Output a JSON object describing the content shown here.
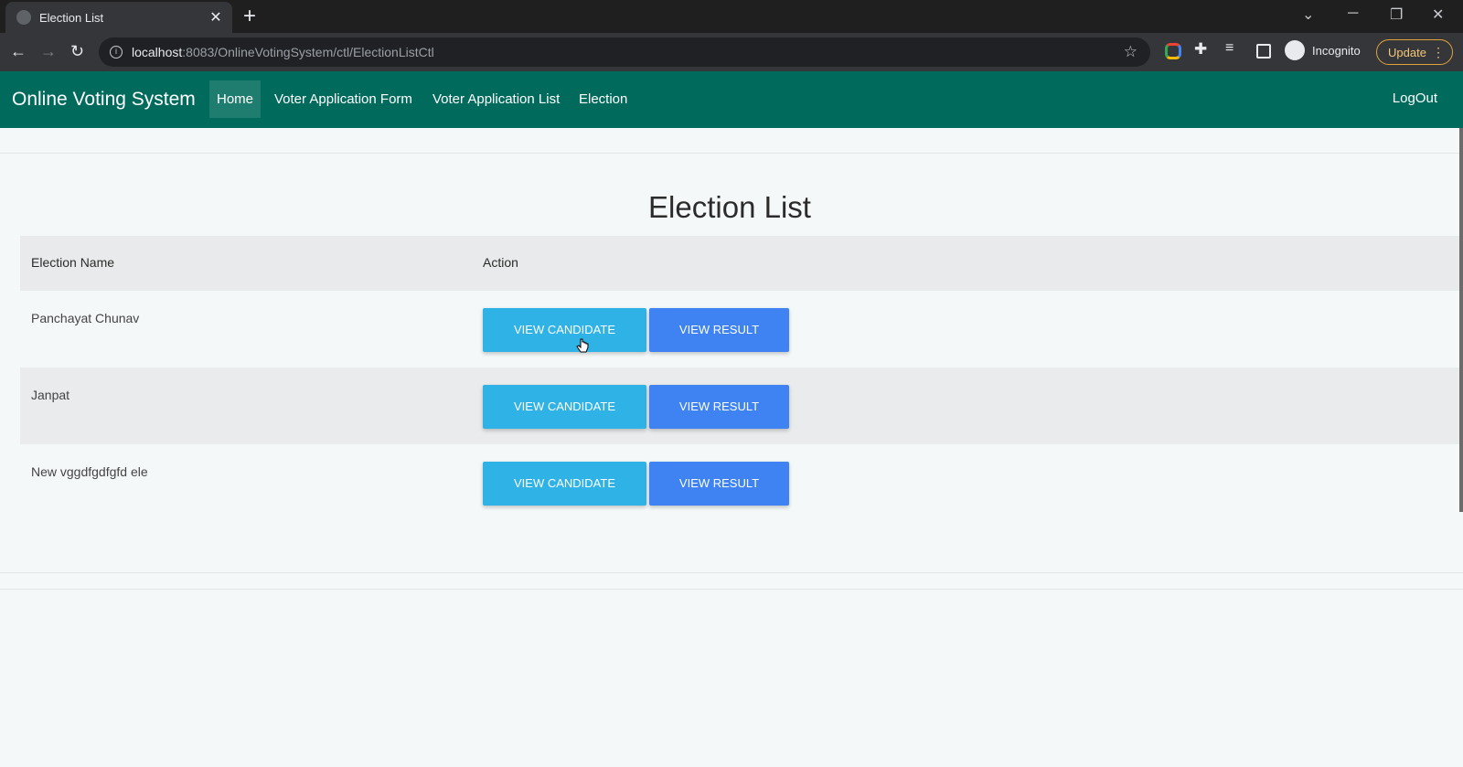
{
  "browser": {
    "tab_title": "Election List",
    "tab_close": "✕",
    "new_tab": "+",
    "url_host": "localhost",
    "url_rest": ":8083/OnlineVotingSystem/ctl/ElectionListCtl",
    "incognito_label": "Incognito",
    "update_label": "Update"
  },
  "navbar": {
    "brand": "Online Voting System",
    "items": [
      {
        "label": "Home",
        "active": true
      },
      {
        "label": "Voter Application Form",
        "active": false
      },
      {
        "label": "Voter Application List",
        "active": false
      },
      {
        "label": "Election",
        "active": false
      }
    ],
    "logout": "LogOut"
  },
  "page": {
    "title": "Election List",
    "table": {
      "headers": [
        "Election Name",
        "Action"
      ],
      "rows": [
        {
          "name": "Panchayat Chunav",
          "view_candidate": "VIEW CANDIDATE",
          "view_result": "VIEW RESULT"
        },
        {
          "name": "Janpat",
          "view_candidate": "VIEW CANDIDATE",
          "view_result": "VIEW RESULT"
        },
        {
          "name": "New vggdfgdfgfd ele",
          "view_candidate": "VIEW CANDIDATE",
          "view_result": "VIEW RESULT"
        }
      ]
    }
  },
  "colors": {
    "navbar_bg": "#006b5c",
    "view_candidate_bg": "#2fb2e6",
    "view_result_bg": "#3f83f2",
    "page_bg": "#f4f8f9"
  }
}
